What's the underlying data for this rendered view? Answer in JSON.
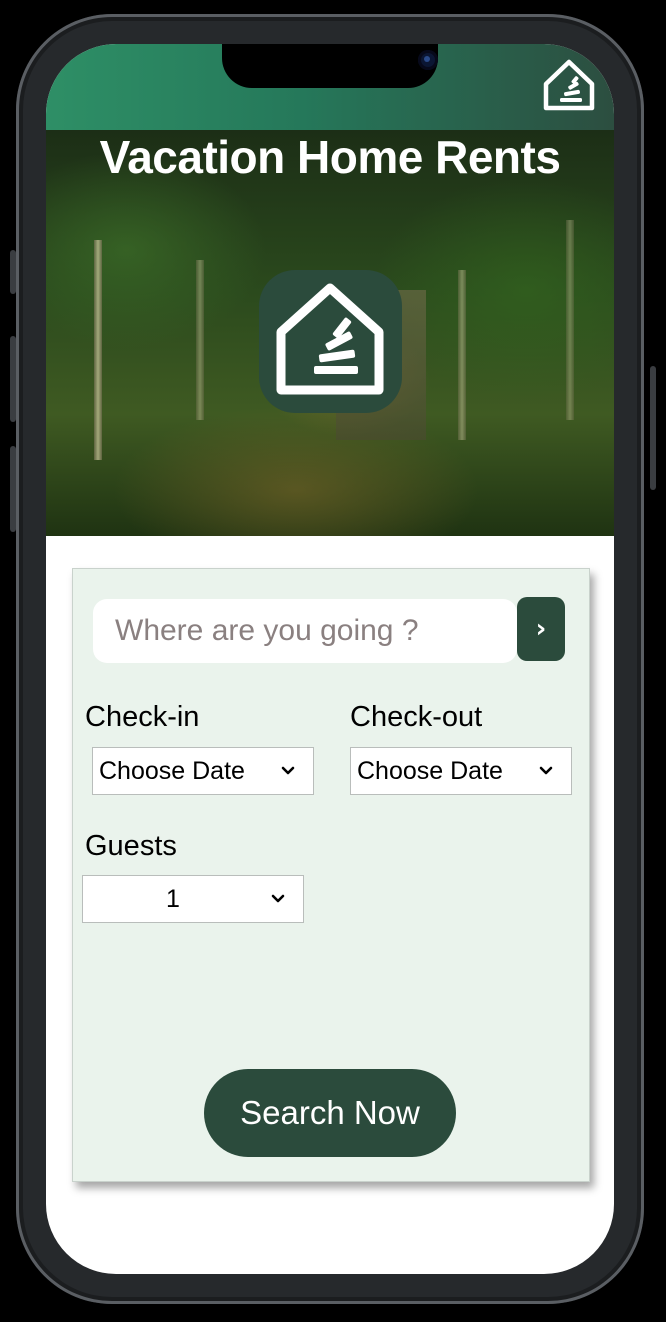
{
  "app": {
    "title": "Vacation Home Rents",
    "logo_icon": "house-stack-logo",
    "accent_color": "#2b4b3c",
    "header_gradient": [
      "#2e8f66",
      "#2c4e40"
    ]
  },
  "search": {
    "placeholder": "Where are you going ?",
    "value": "",
    "go_icon": "chevron-right-icon",
    "go_label": "›"
  },
  "checkin": {
    "label": "Check-in",
    "selected": "Choose Date"
  },
  "checkout": {
    "label": "Check-out",
    "selected": "Choose Date"
  },
  "guests": {
    "label": "Guests",
    "selected": "1"
  },
  "actions": {
    "search_label": "Search Now"
  }
}
